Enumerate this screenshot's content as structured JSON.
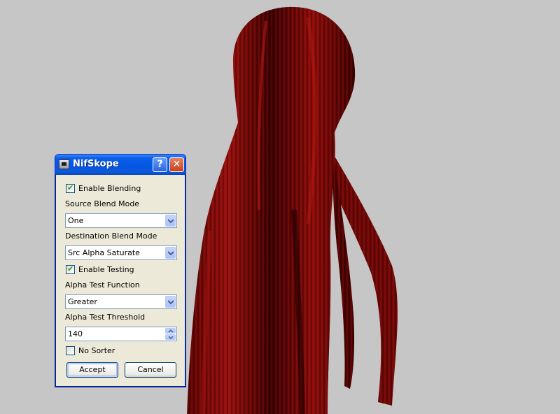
{
  "window": {
    "title": "NifSkope",
    "help_label": "?",
    "close_label": "✕"
  },
  "form": {
    "enable_blending": {
      "label": "Enable Blending",
      "checked": true
    },
    "source_blend_mode": {
      "label": "Source Blend Mode",
      "value": "One"
    },
    "destination_blend_mode": {
      "label": "Destination Blend Mode",
      "value": "Src Alpha Saturate"
    },
    "enable_testing": {
      "label": "Enable Testing",
      "checked": true
    },
    "alpha_test_function": {
      "label": "Alpha Test Function",
      "value": "Greater"
    },
    "alpha_test_threshold": {
      "label": "Alpha Test Threshold",
      "value": "140"
    },
    "no_sorter": {
      "label": "No Sorter",
      "checked": false
    }
  },
  "buttons": {
    "accept": "Accept",
    "cancel": "Cancel"
  },
  "colors": {
    "viewport_bg": "#c6c6c6",
    "hair_dark": "#2a0000",
    "hair_red": "#8a0c0a",
    "titlebar": "#0556e5",
    "dialog_bg": "#ece9d8"
  }
}
